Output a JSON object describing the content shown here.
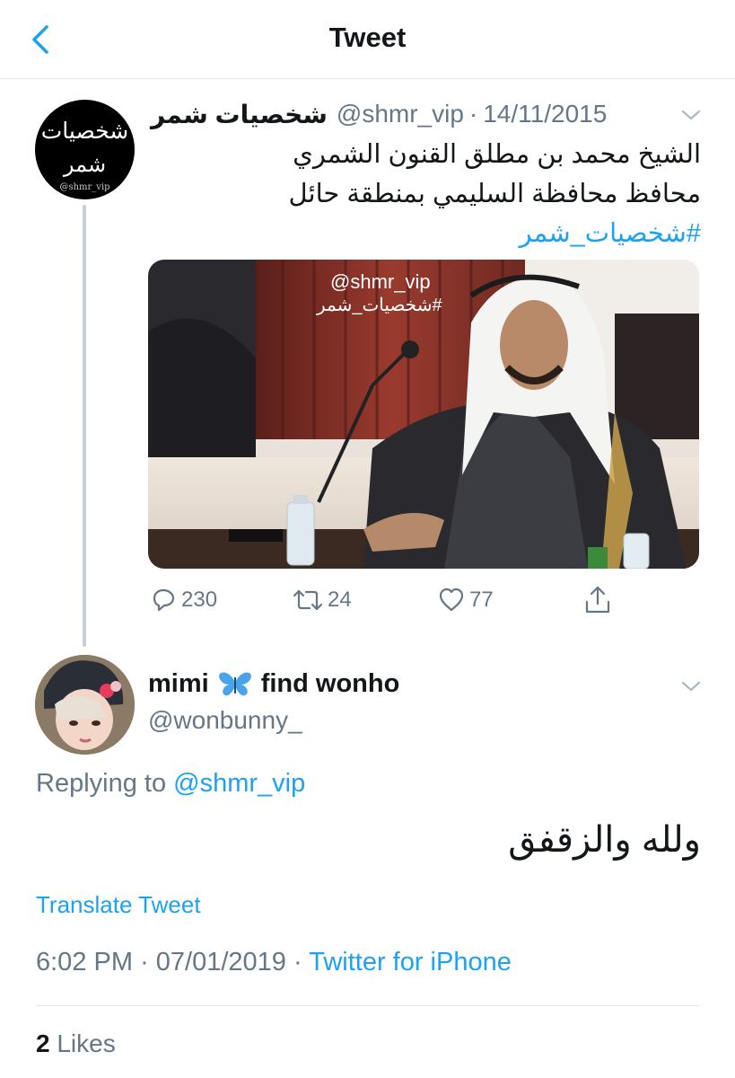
{
  "header": {
    "title": "Tweet"
  },
  "tweet": {
    "author": {
      "name": "شخصيات شمر",
      "handle": "@shmr_vip",
      "avatar_text": [
        "شخصيات",
        "شمر",
        "@shmr_vip"
      ]
    },
    "date": "14/11/2015",
    "text_lines": [
      "الشيخ محمد بن مطلق القنون الشمري",
      "محافظ محافظة السليمي بمنطقة حائل"
    ],
    "hashtag": "#شخصيات_شمر",
    "media_overlay": {
      "handle": "@shmr_vip",
      "hashtag": "#شخصيات_شمر"
    },
    "stats": {
      "replies": "230",
      "retweets": "24",
      "likes": "77"
    }
  },
  "reply": {
    "author": {
      "name_part1": "mimi",
      "emoji": "🦋",
      "name_part2": "find wonho",
      "handle": "@wonbunny_"
    },
    "replying_prefix": "Replying to",
    "replying_to": "@shmr_vip",
    "text": "ولله والزقفق",
    "translate_label": "Translate Tweet",
    "time": "6:02 PM",
    "date": "07/01/2019",
    "source": "Twitter for iPhone",
    "likes_count": "2",
    "likes_label": "Likes"
  },
  "colors": {
    "accent": "#1da1f2",
    "secondary_text": "#657786",
    "primary_text": "#14171a",
    "divider": "#e1e8ed"
  },
  "icons": [
    "back-arrow-icon",
    "chevron-down-icon",
    "reply-icon",
    "retweet-icon",
    "like-icon",
    "share-icon",
    "butterfly-emoji-icon"
  ]
}
